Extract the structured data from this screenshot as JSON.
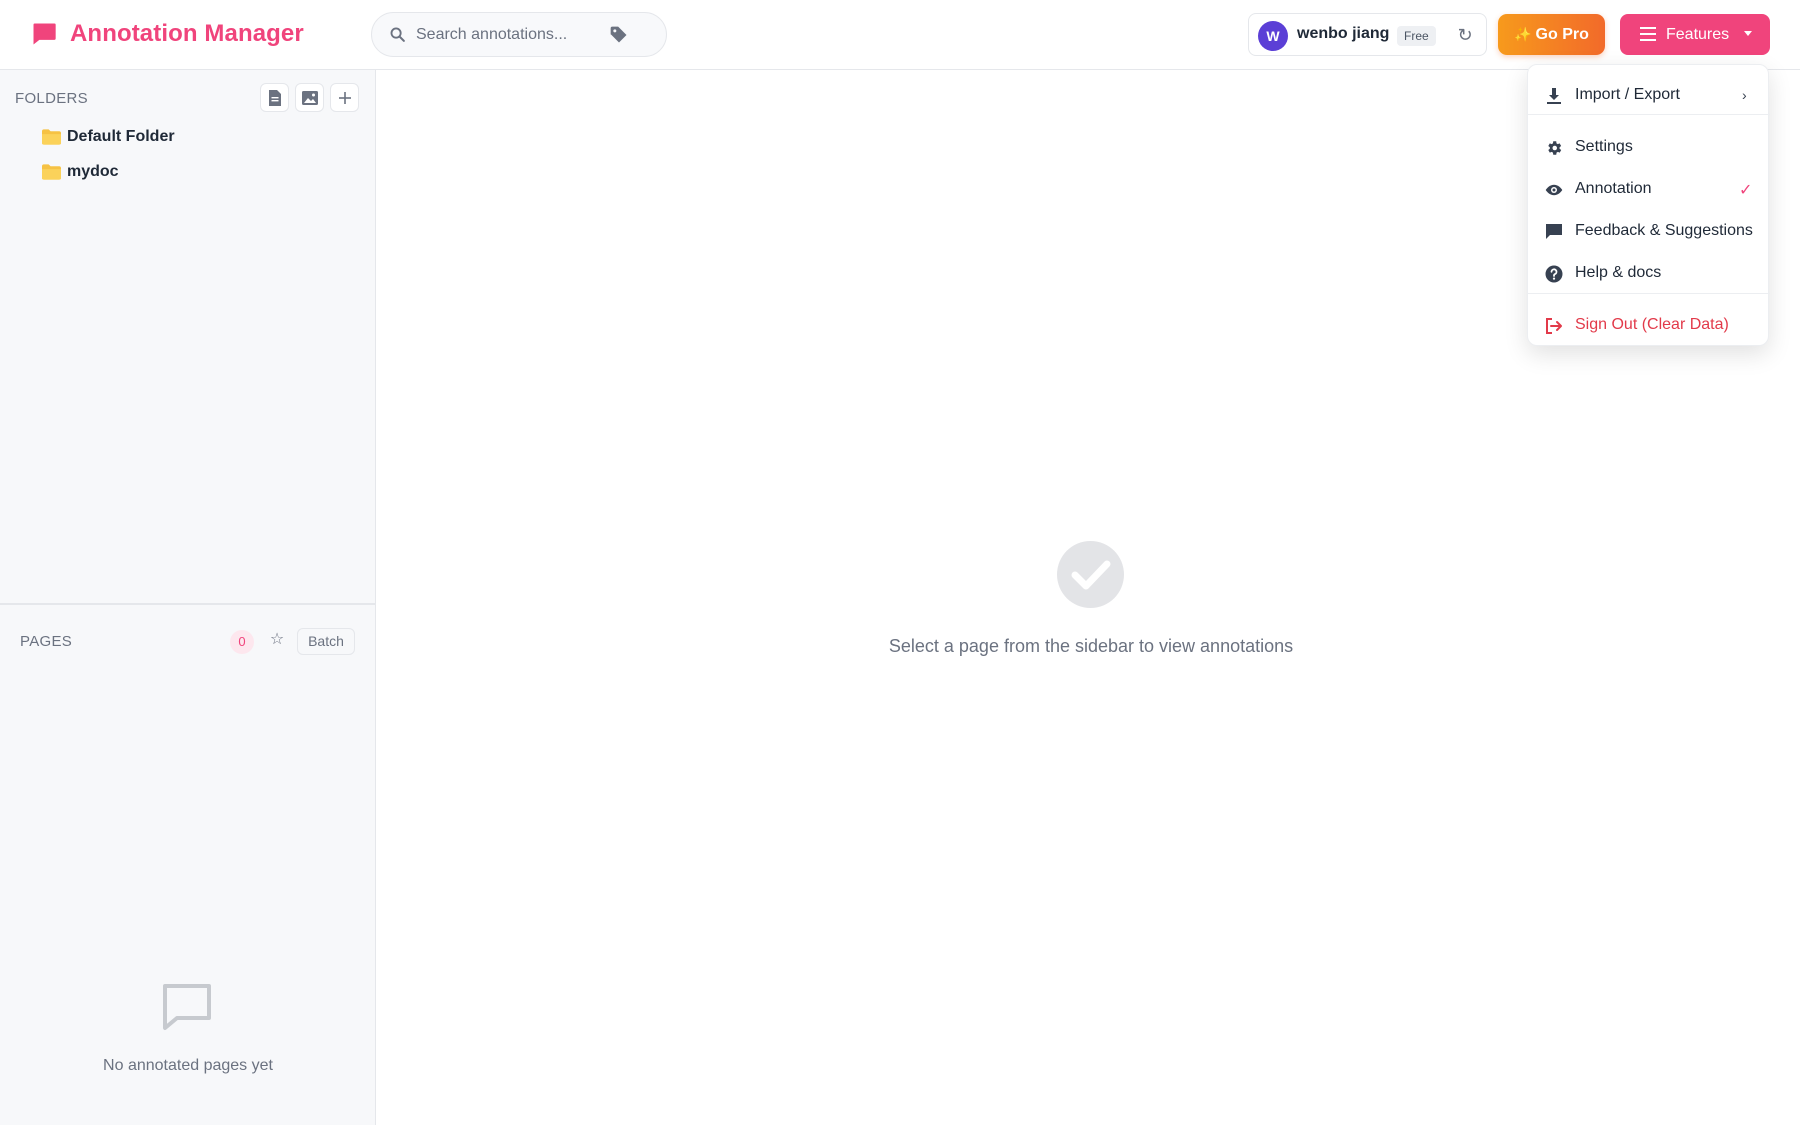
{
  "app": {
    "title": "Annotation Manager",
    "brand_color": "#f0447c"
  },
  "search": {
    "placeholder": "Search annotations...",
    "icon": "search-icon",
    "tag_icon": "tag-icon"
  },
  "user": {
    "avatar_initial": "W",
    "name": "wenbo jiang",
    "plan": "Free",
    "refresh_icon": "refresh-icon",
    "avatar_color": "#5b3fd6"
  },
  "header": {
    "go_pro_label": "Go Pro",
    "features_label": "Features"
  },
  "sidebar": {
    "folders_heading": "FOLDERS",
    "folder_actions": [
      "new-page-icon",
      "image-icon",
      "plus-icon"
    ],
    "folders": [
      {
        "label": "Default Folder"
      },
      {
        "label": "mydoc"
      }
    ],
    "pages_heading": "PAGES",
    "pages_count": "0",
    "batch_label": "Batch",
    "empty_pages_text": "No annotated pages yet"
  },
  "main": {
    "empty_text": "Select a page from the sidebar to view annotations"
  },
  "dropdown": {
    "items": [
      {
        "label": "Import / Export",
        "icon": "download-icon",
        "has_submenu": true
      },
      {
        "label": "Settings",
        "icon": "gear-icon"
      },
      {
        "label": "Annotation",
        "icon": "eye-icon",
        "checked": true,
        "check_mark": "✓"
      },
      {
        "label": "Feedback & Suggestions",
        "icon": "comment-icon"
      },
      {
        "label": "Help & docs",
        "icon": "help-icon"
      },
      {
        "label": "Sign Out (Clear Data)",
        "icon": "sign-out-icon",
        "danger": true
      }
    ]
  }
}
